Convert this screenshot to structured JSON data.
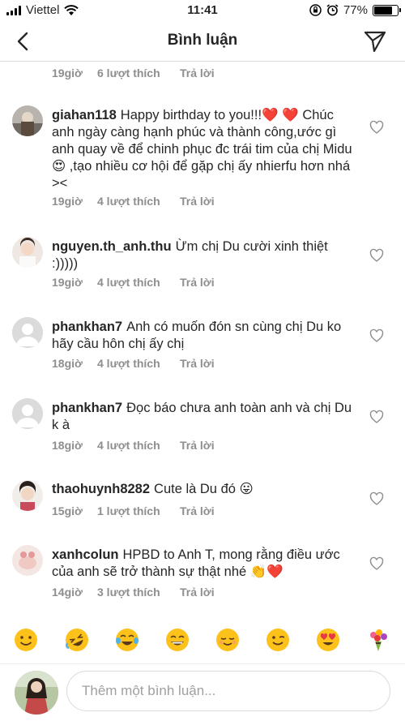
{
  "status_bar": {
    "carrier": "Viettel",
    "time": "11:41",
    "battery": "77%",
    "battery_level": 0.77
  },
  "header": {
    "title": "Bình luận",
    "back_icon": "chevron-left-icon",
    "send_icon": "paper-plane-icon"
  },
  "top_meta": {
    "time": "19giờ",
    "likes": "6 lượt thích",
    "reply": "Trả lời"
  },
  "comments": [
    {
      "username": "giahan118",
      "text": "Happy birthday to you!!!❤️ ❤️  Chúc anh ngày càng hạnh phúc và thành công,ước gì anh quay về để chinh phục đc trái tim của chị Midu😍 ,tạo nhiều cơ hội để gặp chị ấy nhierfu hơn nhá ><",
      "time": "19giờ",
      "likes": "4 lượt thích",
      "reply": "Trả lời"
    },
    {
      "username": "nguyen.th_anh.thu",
      "text": "Ừm chị Du cười xinh thiệt :)))))",
      "time": "19giờ",
      "likes": "4 lượt thích",
      "reply": "Trả lời"
    },
    {
      "username": "phankhan7",
      "text": "Anh có muốn đón sn cùng chị Du ko hãy  cầu hôn chị ấy chị",
      "time": "18giờ",
      "likes": "4 lượt thích",
      "reply": "Trả lời"
    },
    {
      "username": "phankhan7",
      "text": "Đọc báo chưa anh toàn anh và chị Du k à",
      "time": "18giờ",
      "likes": "4 lượt thích",
      "reply": "Trả lời"
    },
    {
      "username": "thaohuynh8282",
      "text": "Cute là Du đó 😛",
      "time": "15giờ",
      "likes": "1 lượt thích",
      "reply": "Trả lời"
    },
    {
      "username": "xanhcolun",
      "text": "HPBD to Anh T, mong rằng điều ước của anh sẽ trở thành sự thật nhé 👏❤️",
      "time": "14giờ",
      "likes": "3 lượt thích",
      "reply": "Trả lời"
    }
  ],
  "emoji_bar": [
    "😊",
    "🤣",
    "😂",
    "😄",
    "☺️",
    "😉",
    "😍",
    "💐"
  ],
  "composer": {
    "placeholder": "Thêm một bình luận..."
  },
  "colors": {
    "text": "#262626",
    "secondary": "#8e8e8e",
    "divider": "#dbdbdb",
    "heart_red": "#ed4956"
  }
}
